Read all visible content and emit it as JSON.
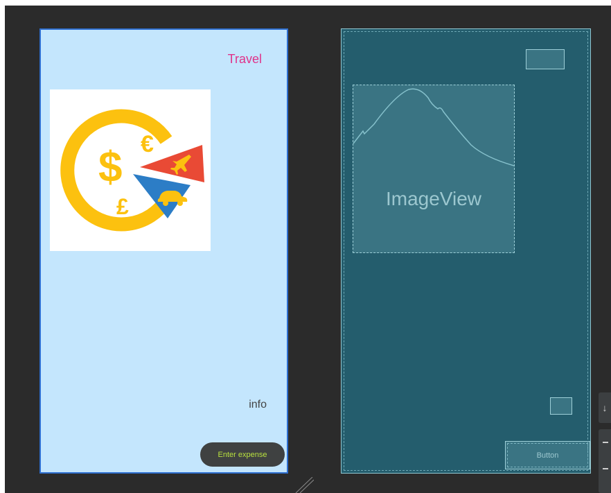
{
  "design_view": {
    "title_text": "Travel",
    "info_text": "info",
    "button_label": "Enter expense",
    "logo_icon": "travel-expense-logo-icon"
  },
  "blueprint_view": {
    "imageview_label": "ImageView",
    "button_label": "Button"
  },
  "colors": {
    "design_bg": "#c4e6fd",
    "blueprint_bg": "#245d6d",
    "title": "#e0338a",
    "button_text": "#b9e23f"
  },
  "side_controls": [
    "download-icon",
    "zoom-icon"
  ]
}
